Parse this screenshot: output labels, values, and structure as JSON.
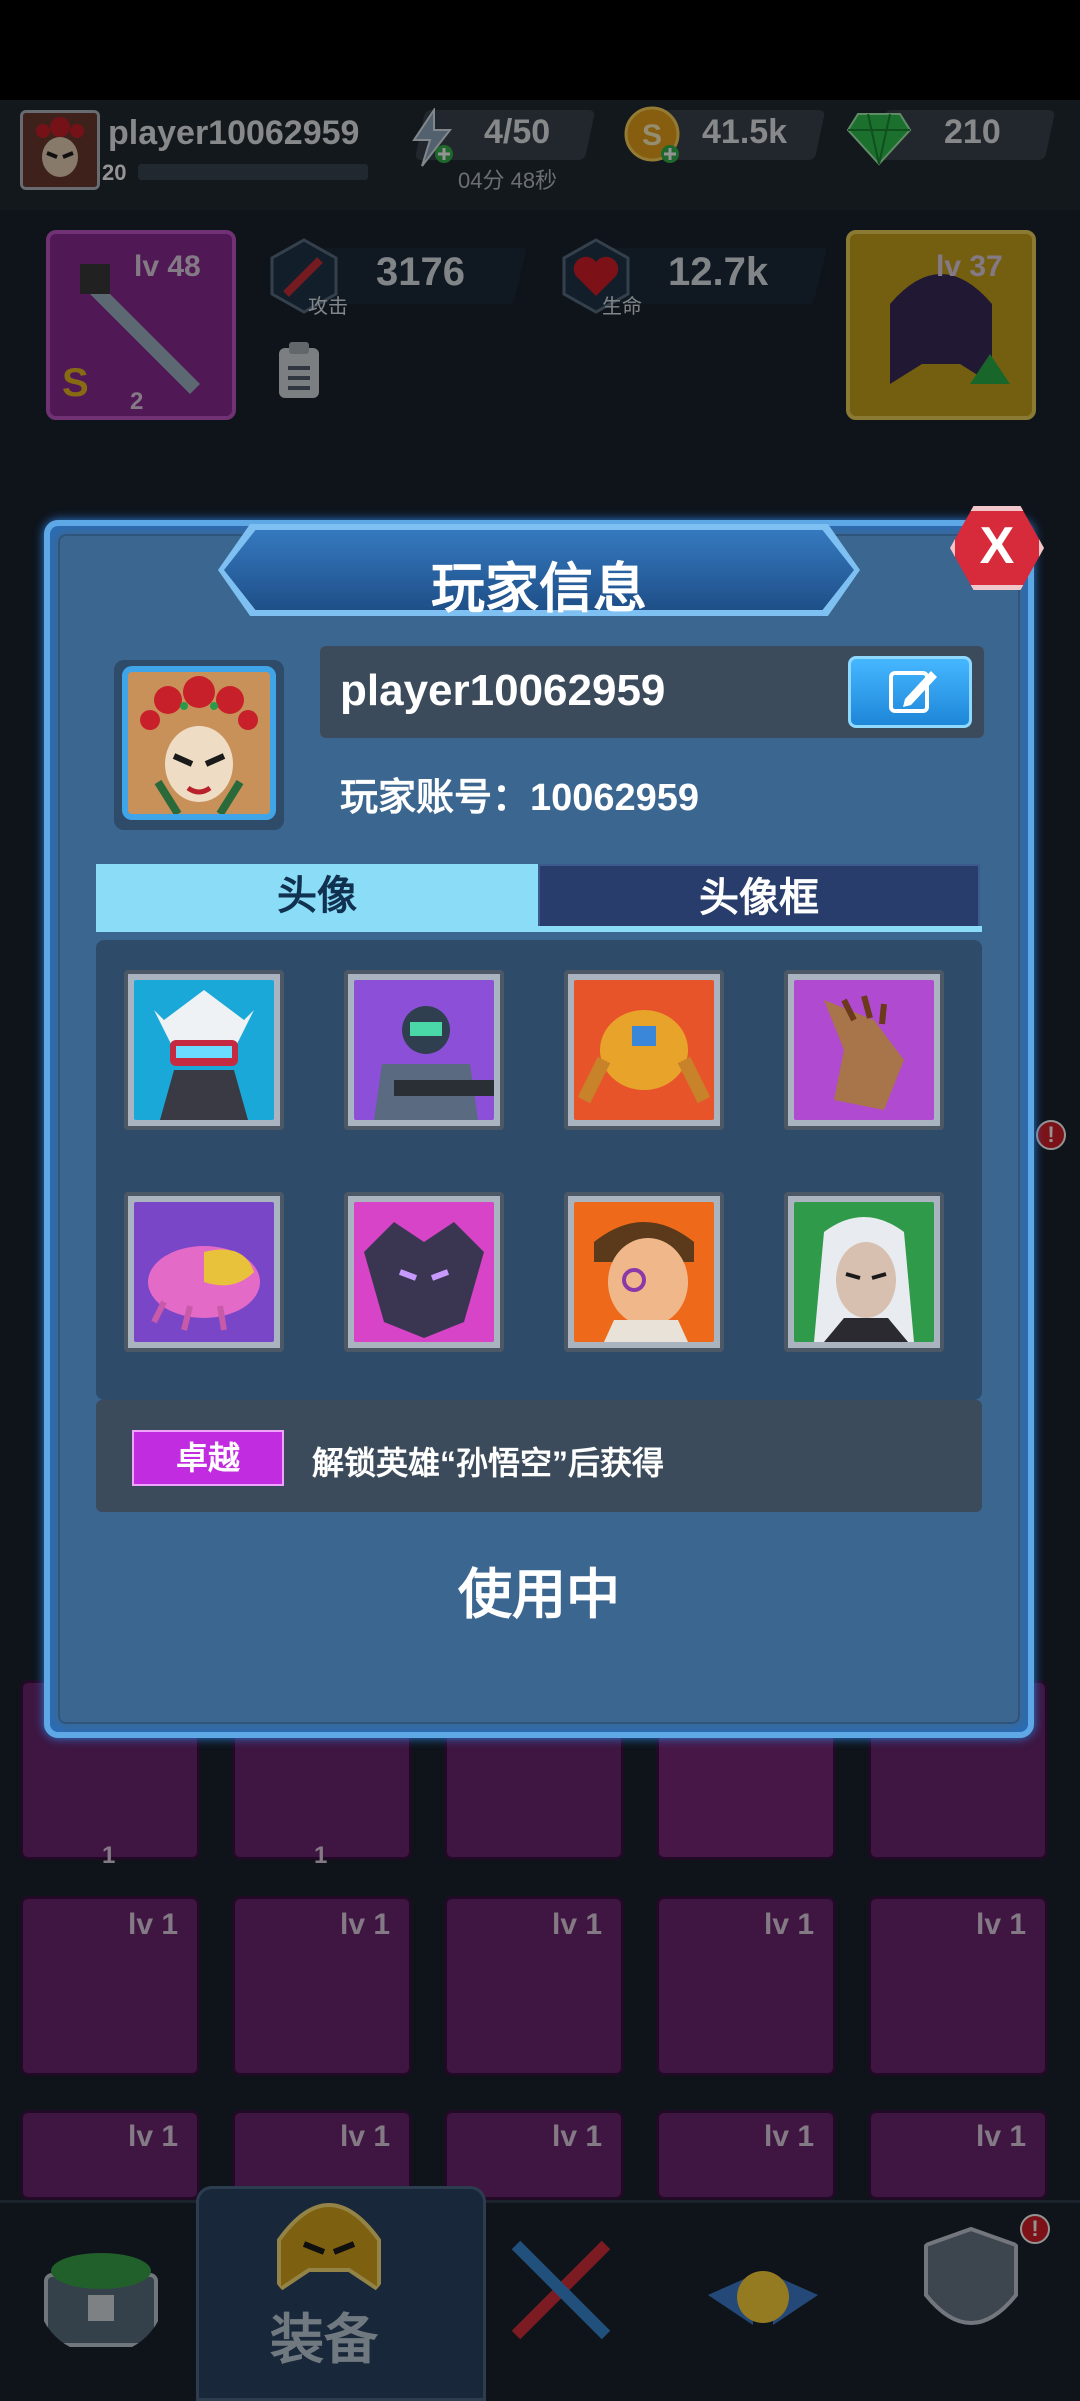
{
  "top_bar": {
    "player_name": "player10062959",
    "level": "20",
    "energy": "4/50",
    "energy_timer": "04分 48秒",
    "gold": "41.5k",
    "gems": "210"
  },
  "hero_stats": {
    "weapon_level": "lv 48",
    "weapon_stars": "2",
    "attack_value": "3176",
    "attack_label": "攻击",
    "hp_value": "12.7k",
    "hp_label": "生命",
    "helmet_level": "lv 37"
  },
  "inventory": {
    "row1_counts": [
      "1",
      "1"
    ],
    "row_levels": [
      "lv 1",
      "lv 1",
      "lv 1",
      "lv 1",
      "lv 1"
    ]
  },
  "bottom_nav": {
    "active_label": "装备"
  },
  "modal": {
    "title": "玩家信息",
    "close_label": "X",
    "player_name": "player10062959",
    "account_line": "玩家账号：10062959",
    "tabs": [
      {
        "label": "头像",
        "active": true
      },
      {
        "label": "头像框",
        "active": false
      }
    ],
    "avatars": [
      {
        "name": "armored-knight-avatar",
        "bg": "#19a8d8"
      },
      {
        "name": "space-marine-avatar",
        "bg": "#8c4fd8"
      },
      {
        "name": "mech-robot-avatar",
        "bg": "#e8542a"
      },
      {
        "name": "alien-beast-avatar",
        "bg": "#b04ad0"
      },
      {
        "name": "crawler-monster-avatar",
        "bg": "#7a46c8"
      },
      {
        "name": "dark-helmet-avatar",
        "bg": "#d844c8"
      },
      {
        "name": "monk-warrior-avatar",
        "bg": "#ee6a1a"
      },
      {
        "name": "white-hair-elf-avatar",
        "bg": "#2f9a4a"
      }
    ],
    "rarity": "卓越",
    "unlock_text": "解锁英雄“孙悟空”后获得",
    "status": "使用中"
  },
  "colors": {
    "accent_blue": "#5ea8e6",
    "tab_active": "#8bdcf6",
    "rarity_purple": "#c12ce0",
    "close_red": "#d72a3a"
  }
}
